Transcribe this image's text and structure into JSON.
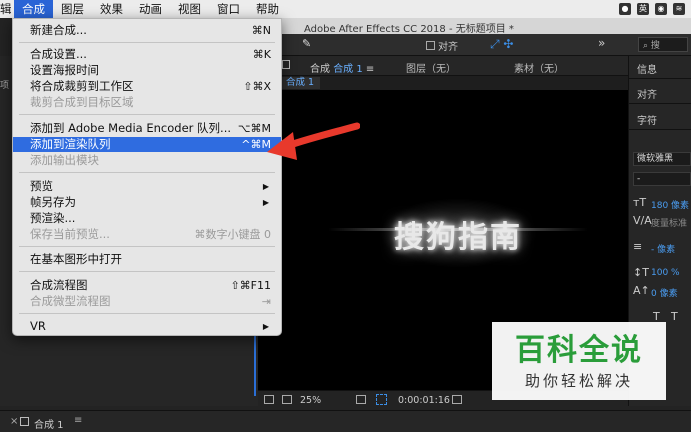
{
  "menubar": {
    "items": [
      "辑",
      "合成",
      "图层",
      "效果",
      "动画",
      "视图",
      "窗口",
      "帮助"
    ],
    "active_index": 1
  },
  "window": {
    "title": "Adobe After Effects CC 2018 - 无标题项目 *"
  },
  "toolbar": {
    "align_label": "对齐",
    "search_placeholder": "搜"
  },
  "comp_panel": {
    "tab_prefix": "合成",
    "tab_name": "合成 1",
    "layer_tab": "图层（无）",
    "footage_tab": "素材（无）",
    "sub_chip": "合成 1",
    "viewer_text": "搜狗指南",
    "zoom": "25%",
    "timecode": "0:00:01:16"
  },
  "left_panel": {
    "tab_stub": "项"
  },
  "right_panel": {
    "info": "信息",
    "align": "对齐",
    "character": "字符",
    "font": "微软雅黑",
    "font_style": "-",
    "size_value": "180 像素",
    "leading_label": "度量标准",
    "stroke_value": "- 像素",
    "scale_value": "100 %",
    "baseline_value": "0 像素"
  },
  "timeline": {
    "comp_name": "合成 1"
  },
  "menu": {
    "items": [
      {
        "label": "新建合成...",
        "shortcut": "⌘N",
        "disabled": false,
        "highlighted": false,
        "submenu": false
      },
      {
        "label": "合成设置...",
        "shortcut": "⌘K",
        "disabled": false,
        "highlighted": false,
        "submenu": false
      },
      {
        "label": "设置海报时间",
        "shortcut": "",
        "disabled": false,
        "highlighted": false,
        "submenu": false
      },
      {
        "label": "将合成裁剪到工作区",
        "shortcut": "⇧⌘X",
        "disabled": false,
        "highlighted": false,
        "submenu": false
      },
      {
        "label": "裁剪合成到目标区域",
        "shortcut": "",
        "disabled": true,
        "highlighted": false,
        "submenu": false
      },
      {
        "label": "添加到 Adobe Media Encoder 队列...",
        "shortcut": "⌥⌘M",
        "disabled": false,
        "highlighted": false,
        "submenu": false
      },
      {
        "label": "添加到渲染队列",
        "shortcut": "^⌘M",
        "disabled": false,
        "highlighted": true,
        "submenu": false
      },
      {
        "label": "添加输出模块",
        "shortcut": "",
        "disabled": true,
        "highlighted": false,
        "submenu": false
      },
      {
        "label": "预览",
        "shortcut": "",
        "disabled": false,
        "highlighted": false,
        "submenu": true
      },
      {
        "label": "帧另存为",
        "shortcut": "",
        "disabled": false,
        "highlighted": false,
        "submenu": true
      },
      {
        "label": "预渲染...",
        "shortcut": "",
        "disabled": false,
        "highlighted": false,
        "submenu": false
      },
      {
        "label": "保存当前预览...",
        "shortcut": "⌘数字小键盘 0",
        "disabled": true,
        "highlighted": false,
        "submenu": false
      },
      {
        "label": "在基本图形中打开",
        "shortcut": "",
        "disabled": false,
        "highlighted": false,
        "submenu": false
      },
      {
        "label": "合成流程图",
        "shortcut": "⇧⌘F11",
        "disabled": false,
        "highlighted": false,
        "submenu": false
      },
      {
        "label": "合成微型流程图",
        "shortcut": "⇥",
        "disabled": true,
        "highlighted": false,
        "submenu": false
      },
      {
        "label": "VR",
        "shortcut": "",
        "disabled": false,
        "highlighted": false,
        "submenu": true
      }
    ]
  },
  "watermark": {
    "brand": "百科全说",
    "tagline": "助你轻松解决"
  },
  "colors": {
    "highlight": "#2f6ce0",
    "annotation_arrow": "#e8392c",
    "watermark_green": "#2a9d3a"
  }
}
